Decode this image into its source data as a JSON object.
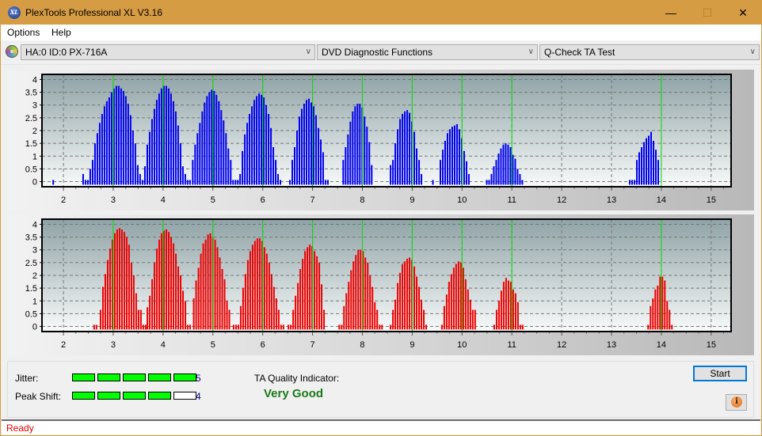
{
  "window": {
    "title": "PlexTools Professional XL V3.16",
    "app_icon_text": "XL",
    "minimize_icon": "—",
    "maximize_icon": "☐",
    "close_icon": "✕",
    "titlebar_color": "#d69c43"
  },
  "menu": {
    "items": [
      {
        "label": "Options"
      },
      {
        "label": "Help"
      }
    ]
  },
  "toolbar": {
    "drive": {
      "value": "HA:0 ID:0  PX-716A",
      "chevron": "∨"
    },
    "function": {
      "value": "DVD Diagnostic Functions",
      "chevron": "∨"
    },
    "test": {
      "value": "Q-Check TA Test",
      "chevron": "∨"
    }
  },
  "chart_data": [
    {
      "type": "bar",
      "name": "TA histogram (upper, blue)",
      "color": "#0000ee",
      "marker_color": "#00e000",
      "xlim": [
        1.57,
        15.4
      ],
      "ylim": [
        -0.2,
        4.2
      ],
      "x_ticks": [
        2,
        3,
        4,
        5,
        6,
        7,
        8,
        9,
        10,
        11,
        12,
        13,
        14,
        15
      ],
      "y_ticks": [
        0,
        0.5,
        1,
        1.5,
        2,
        2.5,
        3,
        3.5,
        4
      ],
      "y_tick_labels": [
        "0",
        "0.5",
        "1",
        "1.5",
        "2",
        "2.5",
        "3",
        "3.5",
        "4"
      ],
      "markers": [
        3,
        4,
        5,
        6,
        7,
        8,
        9,
        10,
        11,
        14
      ],
      "grid": true,
      "clusters": [
        {
          "start": 1.78,
          "values": [
            0
          ]
        },
        {
          "start": 2.38,
          "values": [
            0.3,
            0,
            0,
            0.5,
            0.85,
            1.5,
            1.9,
            2.3,
            2.65,
            2.95,
            3.15,
            3.3,
            3.5,
            3.65,
            3.75,
            3.75,
            3.65,
            3.55,
            3.35,
            3.05,
            2.6,
            2.0,
            1.5,
            0.65,
            0.3,
            0,
            0
          ]
        },
        {
          "start": 3.62,
          "values": [
            0.6,
            1.45,
            1.95,
            2.45,
            2.85,
            3.2,
            3.45,
            3.65,
            3.75,
            3.75,
            3.65,
            3.45,
            3.15,
            2.75,
            2.2,
            1.5,
            0.6,
            0.3,
            0,
            0
          ]
        },
        {
          "start": 4.58,
          "values": [
            0.85,
            1.45,
            1.9,
            2.3,
            2.75,
            3.1,
            3.35,
            3.5,
            3.6,
            3.55,
            3.4,
            3.15,
            2.8,
            2.4,
            1.9,
            1.3,
            0.85,
            0,
            0,
            0
          ]
        },
        {
          "start": 5.53,
          "values": [
            0.3,
            1.2,
            1.85,
            2.3,
            2.65,
            2.95,
            3.2,
            3.35,
            3.45,
            3.4,
            3.3,
            3.0,
            2.65,
            2.1,
            1.35,
            0.85,
            0.3,
            0
          ]
        },
        {
          "start": 6.53,
          "values": [
            0,
            0.85,
            1.35,
            2.0,
            2.55,
            2.85,
            3.05,
            3.2,
            3.25,
            3.1,
            2.95,
            2.6,
            2.1,
            1.65,
            1.15,
            0,
            0
          ]
        },
        {
          "start": 7.6,
          "values": [
            0.85,
            1.35,
            1.85,
            2.35,
            2.75,
            2.95,
            3.05,
            3.05,
            2.9,
            2.55,
            2.15,
            1.55,
            0.65
          ]
        },
        {
          "start": 8.55,
          "values": [
            0.65,
            0.85,
            1.5,
            2.05,
            2.45,
            2.65,
            2.75,
            2.8,
            2.7,
            2.35,
            1.95,
            1.3,
            0.85,
            0.3
          ]
        },
        {
          "start": 9.4,
          "values": [
            0
          ]
        },
        {
          "start": 9.55,
          "values": [
            0.85,
            1.25,
            1.6,
            1.9,
            2.05,
            2.15,
            2.2,
            2.25,
            2.05,
            1.7,
            1.2,
            0.8,
            0.3
          ]
        },
        {
          "start": 10.48,
          "values": [
            0,
            0,
            0.3,
            0.6,
            0.85,
            1.1,
            1.3,
            1.45,
            1.5,
            1.45,
            1.35,
            1.05,
            0.9,
            0.5,
            0.3,
            0
          ]
        },
        {
          "start": 13.35,
          "values": [
            0,
            0,
            0,
            0.85,
            1.15,
            1.35,
            1.55,
            1.7,
            1.8,
            1.95,
            1.6,
            1.25,
            0.85
          ]
        }
      ]
    },
    {
      "type": "bar",
      "name": "TA histogram (lower, red)",
      "color": "#ee0000",
      "marker_color": "#00e000",
      "xlim": [
        1.57,
        15.4
      ],
      "ylim": [
        -0.2,
        4.2
      ],
      "x_ticks": [
        2,
        3,
        4,
        5,
        6,
        7,
        8,
        9,
        10,
        11,
        12,
        13,
        14,
        15
      ],
      "y_ticks": [
        0,
        0.5,
        1,
        1.5,
        2,
        2.5,
        3,
        3.5,
        4
      ],
      "y_tick_labels": [
        "0",
        "0.5",
        "1",
        "1.5",
        "2",
        "2.5",
        "3",
        "3.5",
        "4"
      ],
      "markers": [
        3,
        4,
        5,
        6,
        7,
        8,
        9,
        10,
        11,
        14
      ],
      "grid": true,
      "clusters": [
        {
          "start": 2.6,
          "values": [
            0,
            0
          ]
        },
        {
          "start": 2.73,
          "values": [
            0.65,
            1.55,
            2.05,
            2.6,
            3.05,
            3.4,
            3.65,
            3.8,
            3.85,
            3.8,
            3.7,
            3.5,
            3.2,
            2.5,
            2.0,
            1.3,
            0.65,
            0.65,
            0,
            0
          ]
        },
        {
          "start": 3.67,
          "values": [
            0.75,
            1.2,
            1.85,
            2.5,
            3.05,
            3.4,
            3.65,
            3.75,
            3.8,
            3.7,
            3.5,
            3.25,
            2.85,
            2.35,
            2.0,
            1.4,
            1.0,
            0,
            0
          ]
        },
        {
          "start": 4.6,
          "values": [
            1.1,
            1.8,
            2.3,
            2.85,
            3.25,
            3.4,
            3.6,
            3.65,
            3.5,
            3.4,
            3.1,
            2.7,
            2.25,
            1.85,
            1.0,
            0.65
          ]
        },
        {
          "start": 5.4,
          "values": [
            0,
            0,
            0,
            0.8,
            1.5,
            2.05,
            2.6,
            2.95,
            3.2,
            3.35,
            3.45,
            3.45,
            3.35,
            3.1,
            2.85,
            2.5,
            2.05,
            1.55,
            1.1,
            0.65,
            0,
            0
          ]
        },
        {
          "start": 6.5,
          "values": [
            0,
            0,
            0.65,
            1.2,
            1.7,
            2.25,
            2.65,
            2.95,
            3.1,
            3.2,
            3.15,
            2.95,
            2.75,
            2.5,
            1.65,
            0.65
          ]
        },
        {
          "start": 7.52,
          "values": [
            0,
            0,
            0.8,
            1.3,
            1.75,
            2.2,
            2.55,
            2.8,
            3.0,
            3.0,
            2.95,
            2.7,
            2.5,
            2.0,
            1.55,
            0.95,
            0.65,
            0,
            0
          ]
        },
        {
          "start": 8.55,
          "values": [
            0,
            0.65,
            1.05,
            1.7,
            2.1,
            2.45,
            2.55,
            2.65,
            2.7,
            2.6,
            2.35,
            1.95,
            1.55,
            1.05,
            0.65,
            0
          ]
        },
        {
          "start": 9.58,
          "values": [
            0,
            0.8,
            1.25,
            1.75,
            2.05,
            2.3,
            2.45,
            2.55,
            2.5,
            2.3,
            1.85,
            1.45,
            1.05,
            0.65,
            0.65
          ]
        },
        {
          "start": 10.63,
          "values": [
            0,
            0.65,
            1.0,
            1.4,
            1.75,
            1.9,
            1.8,
            1.75,
            1.45,
            1.3,
            0.95,
            0,
            0
          ]
        },
        {
          "start": 13.72,
          "values": [
            0,
            0.8,
            1.1,
            1.45,
            1.6,
            1.95,
            1.95,
            1.8,
            1.0,
            0.65,
            0
          ]
        }
      ]
    }
  ],
  "results": {
    "jitter": {
      "label": "Jitter:",
      "value": 5,
      "max": 5,
      "display": "5"
    },
    "peak_shift": {
      "label": "Peak Shift:",
      "value": 4,
      "max": 5,
      "display": "4"
    },
    "ta_quality": {
      "label": "TA Quality Indicator:",
      "value": "Very Good",
      "color": "#1a7a1a"
    },
    "start_button": "Start",
    "info_icon": "i"
  },
  "status": {
    "text": "Ready",
    "color": "#e00000"
  }
}
